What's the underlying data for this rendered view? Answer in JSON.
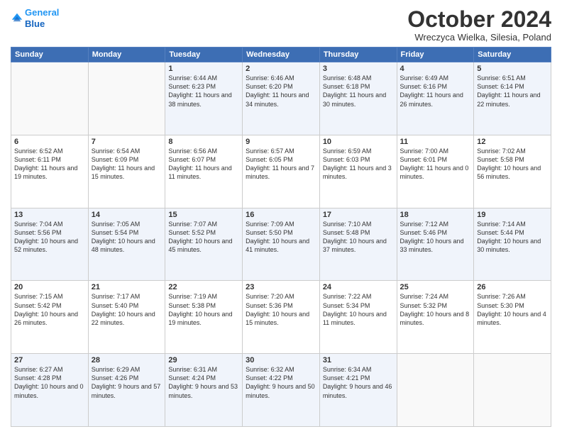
{
  "header": {
    "logo_line1": "General",
    "logo_line2": "Blue",
    "month": "October 2024",
    "location": "Wreczyca Wielka, Silesia, Poland"
  },
  "days_of_week": [
    "Sunday",
    "Monday",
    "Tuesday",
    "Wednesday",
    "Thursday",
    "Friday",
    "Saturday"
  ],
  "weeks": [
    [
      {
        "day": "",
        "text": ""
      },
      {
        "day": "",
        "text": ""
      },
      {
        "day": "1",
        "text": "Sunrise: 6:44 AM\nSunset: 6:23 PM\nDaylight: 11 hours and 38 minutes."
      },
      {
        "day": "2",
        "text": "Sunrise: 6:46 AM\nSunset: 6:20 PM\nDaylight: 11 hours and 34 minutes."
      },
      {
        "day": "3",
        "text": "Sunrise: 6:48 AM\nSunset: 6:18 PM\nDaylight: 11 hours and 30 minutes."
      },
      {
        "day": "4",
        "text": "Sunrise: 6:49 AM\nSunset: 6:16 PM\nDaylight: 11 hours and 26 minutes."
      },
      {
        "day": "5",
        "text": "Sunrise: 6:51 AM\nSunset: 6:14 PM\nDaylight: 11 hours and 22 minutes."
      }
    ],
    [
      {
        "day": "6",
        "text": "Sunrise: 6:52 AM\nSunset: 6:11 PM\nDaylight: 11 hours and 19 minutes."
      },
      {
        "day": "7",
        "text": "Sunrise: 6:54 AM\nSunset: 6:09 PM\nDaylight: 11 hours and 15 minutes."
      },
      {
        "day": "8",
        "text": "Sunrise: 6:56 AM\nSunset: 6:07 PM\nDaylight: 11 hours and 11 minutes."
      },
      {
        "day": "9",
        "text": "Sunrise: 6:57 AM\nSunset: 6:05 PM\nDaylight: 11 hours and 7 minutes."
      },
      {
        "day": "10",
        "text": "Sunrise: 6:59 AM\nSunset: 6:03 PM\nDaylight: 11 hours and 3 minutes."
      },
      {
        "day": "11",
        "text": "Sunrise: 7:00 AM\nSunset: 6:01 PM\nDaylight: 11 hours and 0 minutes."
      },
      {
        "day": "12",
        "text": "Sunrise: 7:02 AM\nSunset: 5:58 PM\nDaylight: 10 hours and 56 minutes."
      }
    ],
    [
      {
        "day": "13",
        "text": "Sunrise: 7:04 AM\nSunset: 5:56 PM\nDaylight: 10 hours and 52 minutes."
      },
      {
        "day": "14",
        "text": "Sunrise: 7:05 AM\nSunset: 5:54 PM\nDaylight: 10 hours and 48 minutes."
      },
      {
        "day": "15",
        "text": "Sunrise: 7:07 AM\nSunset: 5:52 PM\nDaylight: 10 hours and 45 minutes."
      },
      {
        "day": "16",
        "text": "Sunrise: 7:09 AM\nSunset: 5:50 PM\nDaylight: 10 hours and 41 minutes."
      },
      {
        "day": "17",
        "text": "Sunrise: 7:10 AM\nSunset: 5:48 PM\nDaylight: 10 hours and 37 minutes."
      },
      {
        "day": "18",
        "text": "Sunrise: 7:12 AM\nSunset: 5:46 PM\nDaylight: 10 hours and 33 minutes."
      },
      {
        "day": "19",
        "text": "Sunrise: 7:14 AM\nSunset: 5:44 PM\nDaylight: 10 hours and 30 minutes."
      }
    ],
    [
      {
        "day": "20",
        "text": "Sunrise: 7:15 AM\nSunset: 5:42 PM\nDaylight: 10 hours and 26 minutes."
      },
      {
        "day": "21",
        "text": "Sunrise: 7:17 AM\nSunset: 5:40 PM\nDaylight: 10 hours and 22 minutes."
      },
      {
        "day": "22",
        "text": "Sunrise: 7:19 AM\nSunset: 5:38 PM\nDaylight: 10 hours and 19 minutes."
      },
      {
        "day": "23",
        "text": "Sunrise: 7:20 AM\nSunset: 5:36 PM\nDaylight: 10 hours and 15 minutes."
      },
      {
        "day": "24",
        "text": "Sunrise: 7:22 AM\nSunset: 5:34 PM\nDaylight: 10 hours and 11 minutes."
      },
      {
        "day": "25",
        "text": "Sunrise: 7:24 AM\nSunset: 5:32 PM\nDaylight: 10 hours and 8 minutes."
      },
      {
        "day": "26",
        "text": "Sunrise: 7:26 AM\nSunset: 5:30 PM\nDaylight: 10 hours and 4 minutes."
      }
    ],
    [
      {
        "day": "27",
        "text": "Sunrise: 6:27 AM\nSunset: 4:28 PM\nDaylight: 10 hours and 0 minutes."
      },
      {
        "day": "28",
        "text": "Sunrise: 6:29 AM\nSunset: 4:26 PM\nDaylight: 9 hours and 57 minutes."
      },
      {
        "day": "29",
        "text": "Sunrise: 6:31 AM\nSunset: 4:24 PM\nDaylight: 9 hours and 53 minutes."
      },
      {
        "day": "30",
        "text": "Sunrise: 6:32 AM\nSunset: 4:22 PM\nDaylight: 9 hours and 50 minutes."
      },
      {
        "day": "31",
        "text": "Sunrise: 6:34 AM\nSunset: 4:21 PM\nDaylight: 9 hours and 46 minutes."
      },
      {
        "day": "",
        "text": ""
      },
      {
        "day": "",
        "text": ""
      }
    ]
  ]
}
